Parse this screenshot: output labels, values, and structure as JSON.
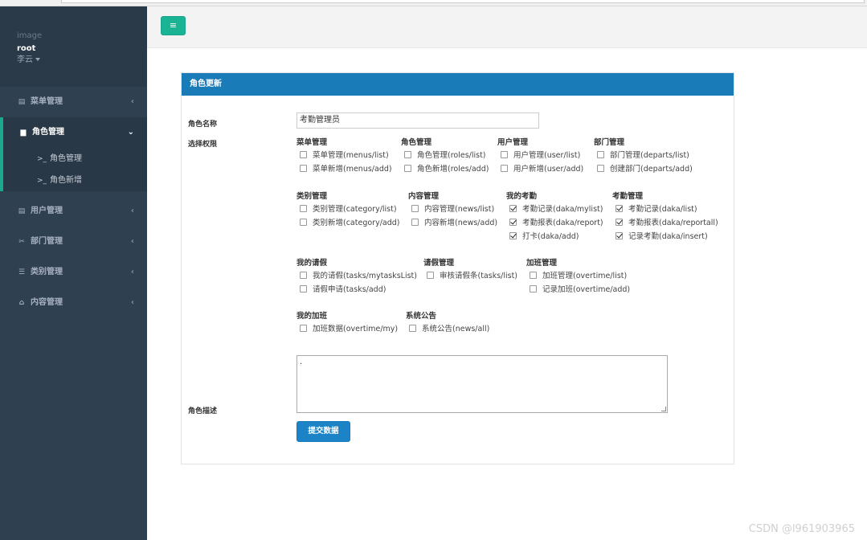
{
  "sidebar": {
    "profile": {
      "image_alt": "image",
      "name": "root",
      "role": "李云"
    },
    "menu": [
      {
        "label": "菜单管理",
        "icon": "file-icon",
        "glyph": "▤"
      },
      {
        "label": "角色管理",
        "icon": "file-icon",
        "glyph": "▆",
        "children": [
          "角色管理",
          "角色新增"
        ]
      },
      {
        "label": "用户管理",
        "icon": "file-icon",
        "glyph": "▤"
      },
      {
        "label": "部门管理",
        "icon": "scissors-icon",
        "glyph": "✂"
      },
      {
        "label": "类别管理",
        "icon": "list-icon",
        "glyph": "☰"
      },
      {
        "label": "内容管理",
        "icon": "home-icon",
        "glyph": "⌂"
      }
    ],
    "sub_prefix": ">_",
    "arrow_left": "‹",
    "arrow_down": "⌄"
  },
  "header": {
    "menu_icon": "≡"
  },
  "panel": {
    "title": "角色更新",
    "name_label": "角色名称",
    "name_value": "考勤管理员",
    "perm_label": "选择权限",
    "desc_label": "角色描述",
    "desc_value": ".",
    "submit_label": "提交数据",
    "groups": [
      {
        "name": "菜单管理",
        "items": [
          {
            "label": "菜单管理(menus/list)",
            "checked": false
          },
          {
            "label": "菜单新增(menus/add)",
            "checked": false
          }
        ]
      },
      {
        "name": "角色管理",
        "items": [
          {
            "label": "角色管理(roles/list)",
            "checked": false
          },
          {
            "label": "角色新增(roles/add)",
            "checked": false
          }
        ]
      },
      {
        "name": "用户管理",
        "items": [
          {
            "label": "用户管理(user/list)",
            "checked": false
          },
          {
            "label": "用户新增(user/add)",
            "checked": false
          }
        ]
      },
      {
        "name": "部门管理",
        "items": [
          {
            "label": "部门管理(departs/list)",
            "checked": false
          },
          {
            "label": "创建部门(departs/add)",
            "checked": false
          }
        ]
      },
      {
        "name": "类别管理",
        "items": [
          {
            "label": "类别管理(category/list)",
            "checked": false
          },
          {
            "label": "类别新增(category/add)",
            "checked": false
          }
        ]
      },
      {
        "name": "内容管理",
        "items": [
          {
            "label": "内容管理(news/list)",
            "checked": false
          },
          {
            "label": "内容新增(news/add)",
            "checked": false
          }
        ]
      },
      {
        "name": "我的考勤",
        "items": [
          {
            "label": "考勤记录(daka/mylist)",
            "checked": true
          },
          {
            "label": "考勤报表(daka/report)",
            "checked": true
          },
          {
            "label": "打卡(daka/add)",
            "checked": true
          }
        ]
      },
      {
        "name": "考勤管理",
        "items": [
          {
            "label": "考勤记录(daka/list)",
            "checked": true
          },
          {
            "label": "考勤报表(daka/reportall)",
            "checked": true
          },
          {
            "label": "记录考勤(daka/insert)",
            "checked": true
          }
        ]
      },
      {
        "name": "我的请假",
        "items": [
          {
            "label": "我的请假(tasks/mytasksList)",
            "checked": false
          },
          {
            "label": "请假申请(tasks/add)",
            "checked": false
          }
        ]
      },
      {
        "name": "请假管理",
        "items": [
          {
            "label": "审核请假条(tasks/list)",
            "checked": false
          }
        ]
      },
      {
        "name": "加班管理",
        "items": [
          {
            "label": "加班管理(overtime/list)",
            "checked": false
          },
          {
            "label": "记录加班(overtime/add)",
            "checked": false
          }
        ]
      },
      {
        "name": "我的加班",
        "items": [
          {
            "label": "加班数据(overtime/my)",
            "checked": false
          }
        ]
      },
      {
        "name": "系统公告",
        "items": [
          {
            "label": "系统公告(news/all)",
            "checked": false
          }
        ]
      }
    ]
  },
  "watermark": "CSDN @l961903965"
}
